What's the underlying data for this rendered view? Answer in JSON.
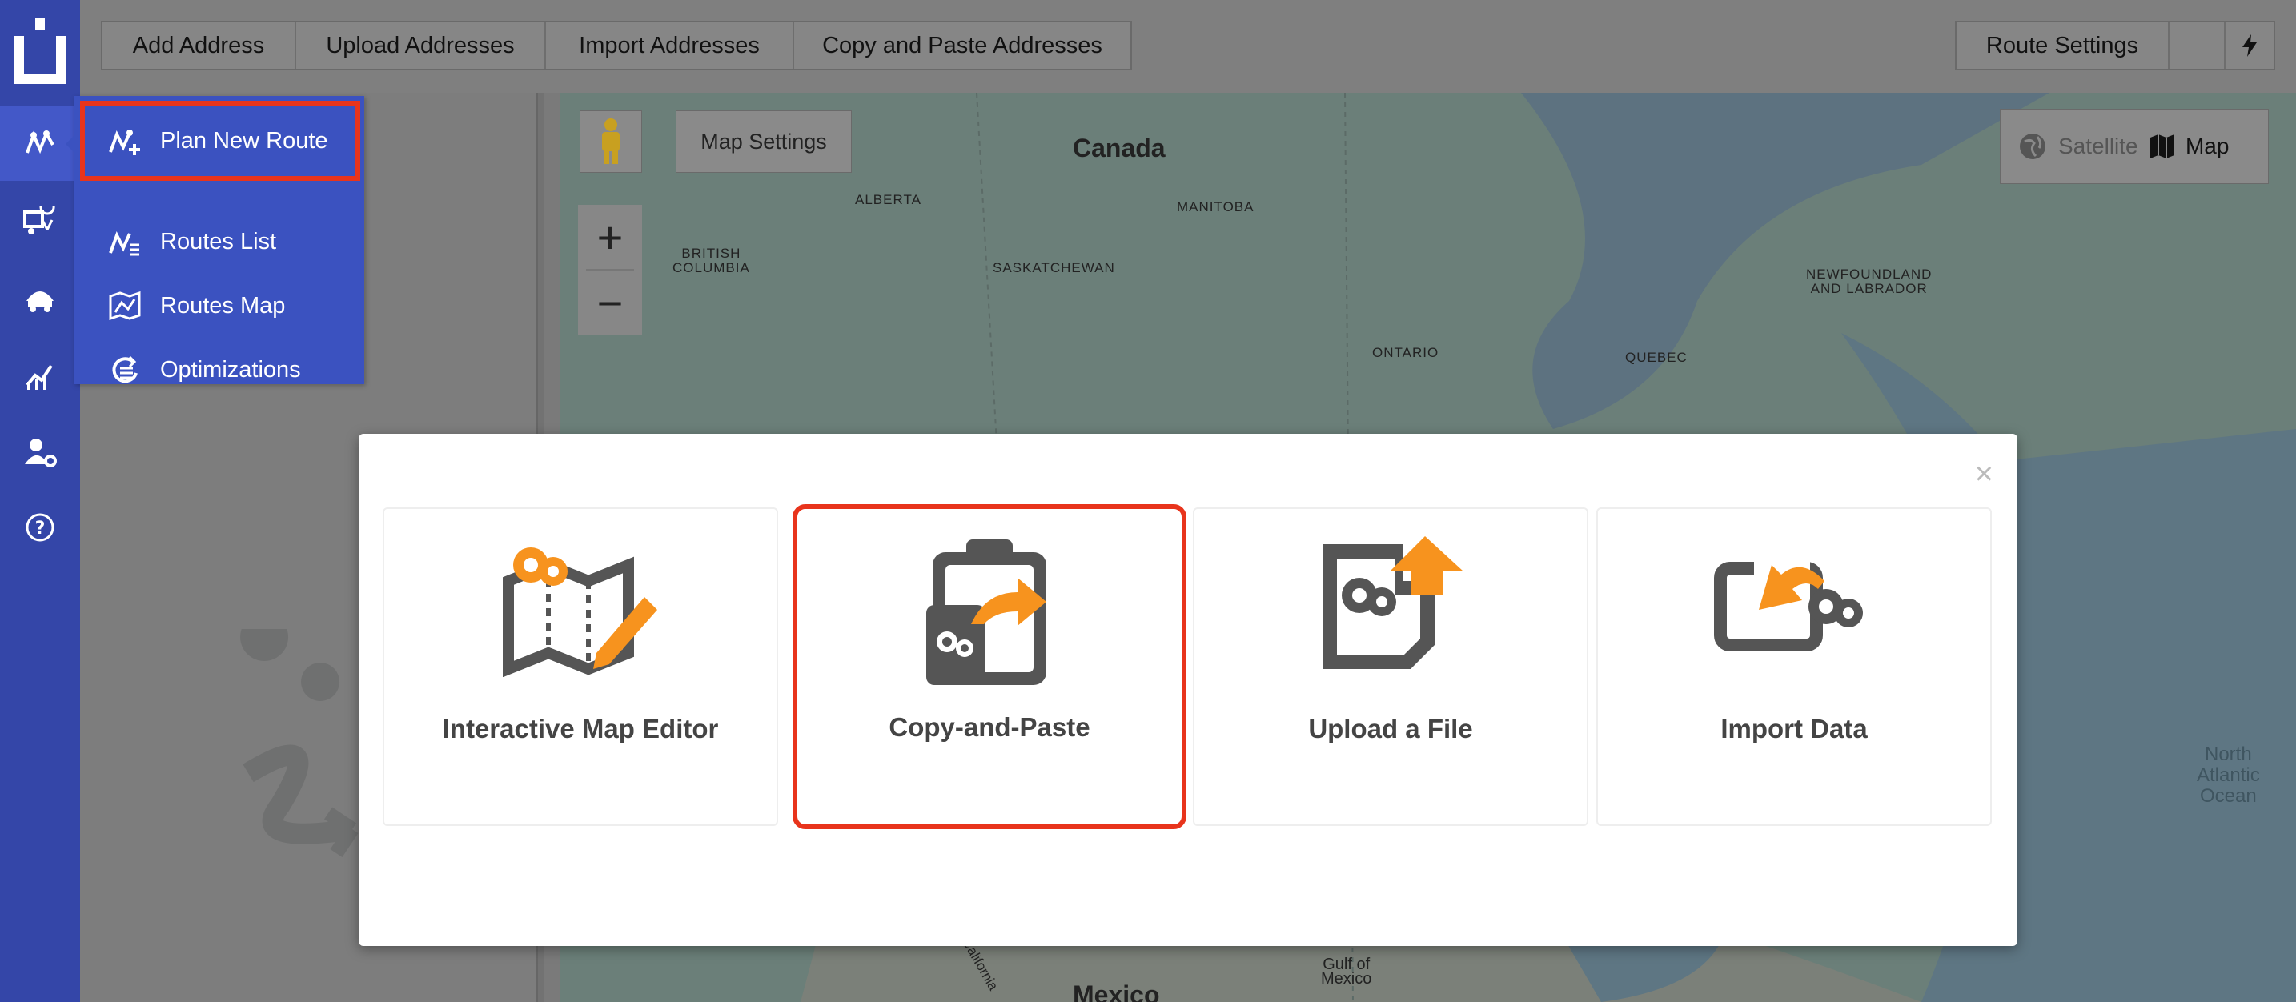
{
  "toolbar": {
    "add_address": "Add Address",
    "upload_addresses": "Upload Addresses",
    "import_addresses": "Import Addresses",
    "copy_paste_addresses": "Copy and Paste Addresses",
    "route_settings": "Route Settings"
  },
  "menu": {
    "items": [
      {
        "label": "Plan New Route",
        "icon": "route-plus-icon",
        "highlighted": true
      },
      {
        "label": "Routes List",
        "icon": "route-list-icon"
      },
      {
        "label": "Routes Map",
        "icon": "routes-map-icon"
      },
      {
        "label": "Optimizations",
        "icon": "optimizations-icon"
      }
    ]
  },
  "map": {
    "settings_label": "Map Settings",
    "type_satellite": "Satellite",
    "type_map": "Map",
    "labels": {
      "canada": "Canada",
      "alberta": "ALBERTA",
      "manitoba": "MANITOBA",
      "british_columbia": "BRITISH\nCOLUMBIA",
      "saskatchewan": "SASKATCHEWAN",
      "newfoundland": "NEWFOUNDLAND\nAND LABRADOR",
      "ontario": "ONTARIO",
      "quebec": "QUEBEC",
      "north_atlantic": "North\nAtlantic\nOcean",
      "gulf_mexico": "Gulf of\nMexico",
      "mexico": "Mexico",
      "california": "California"
    }
  },
  "modal": {
    "close": "×",
    "options": [
      {
        "title": "Interactive Map Editor"
      },
      {
        "title": "Copy-and-Paste",
        "selected": true
      },
      {
        "title": "Upload a File"
      },
      {
        "title": "Import Data"
      }
    ]
  },
  "colors": {
    "rail": "#3446a8",
    "menu": "#3b52c0",
    "highlight": "#e8341c",
    "icon_orange": "#f7931e",
    "icon_dark": "#555555"
  }
}
